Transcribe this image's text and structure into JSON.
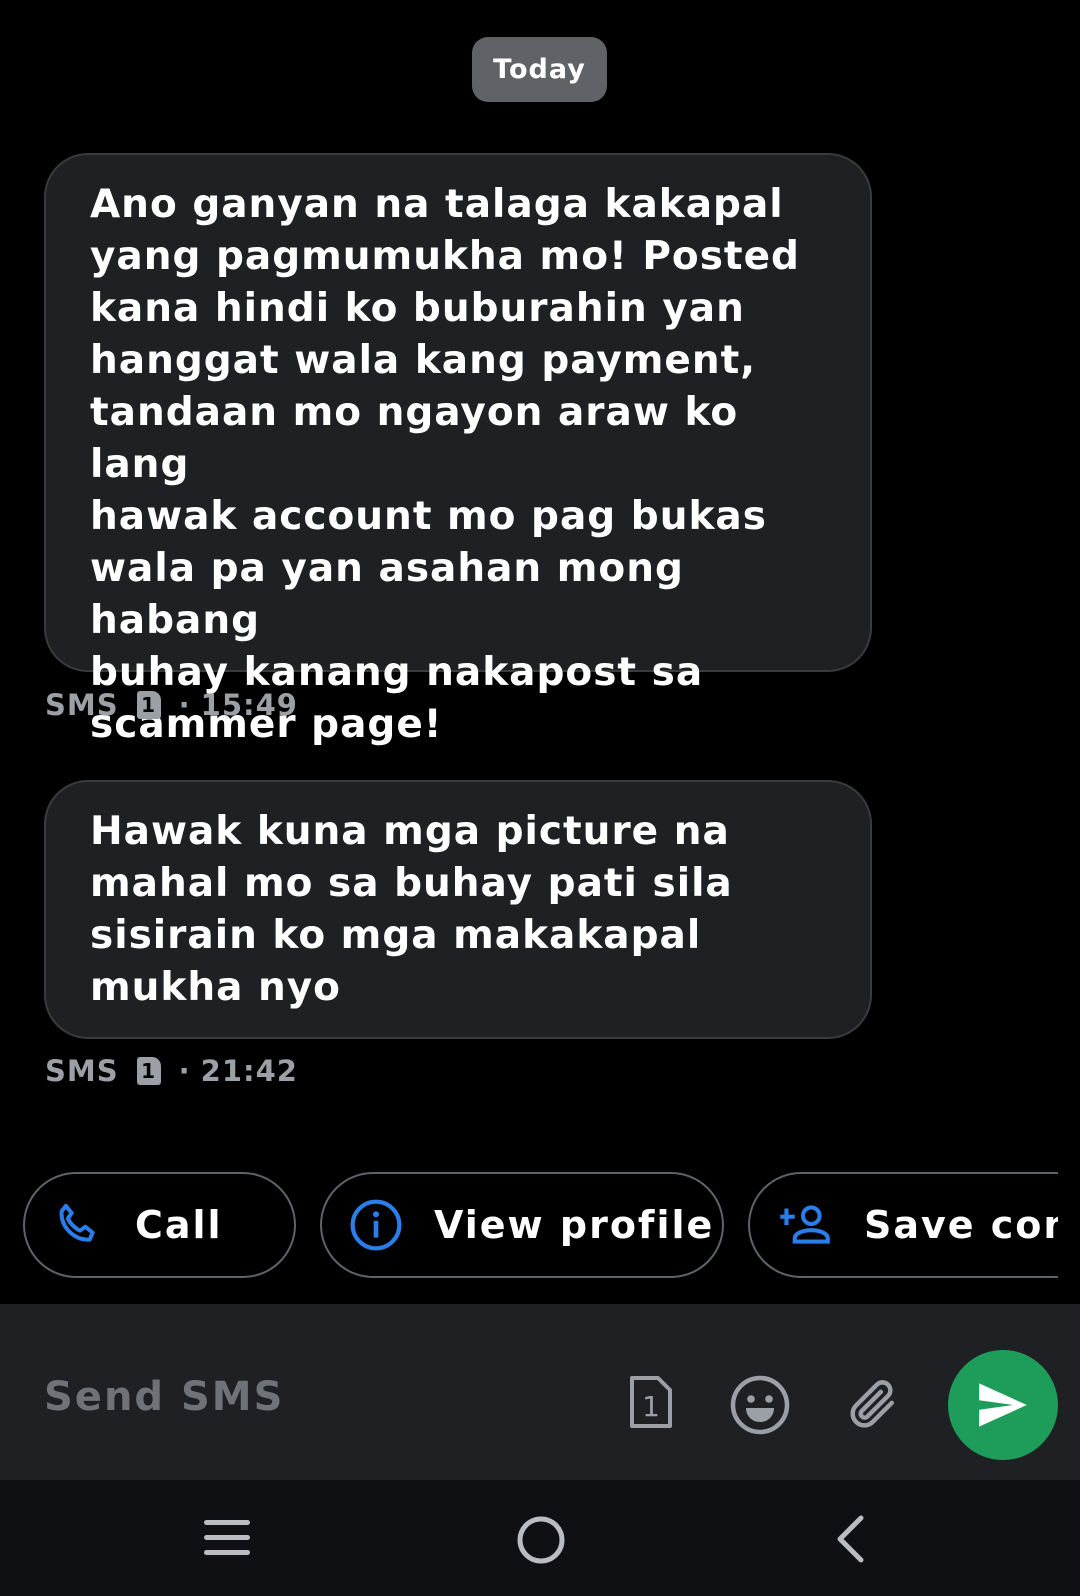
{
  "date_divider": "Today",
  "messages": [
    {
      "text": "Ano ganyan na talaga kakapal\nyang pagmumukha mo! Posted\nkana hindi ko buburahin yan\nhanggat wala kang payment,\ntandaan mo ngayon araw ko lang\nhawak account mo pag bukas\nwala pa yan asahan mong habang\nbuhay kanang nakapost sa\nscammer page!",
      "type": "SMS",
      "sim": "1",
      "time": "15:49"
    },
    {
      "text": "Hawak kuna mga picture na\nmahal mo sa buhay pati sila\nsisirain ko mga makakapal\nmukha nyo",
      "type": "SMS",
      "sim": "1",
      "time": "21:42"
    }
  ],
  "suggestions": {
    "call": "Call",
    "view_profile": "View profile",
    "save_contact": "Save contact"
  },
  "composer": {
    "placeholder": "Send SMS",
    "sim_label": "1"
  },
  "icons": {
    "call": "phone-icon",
    "view_profile": "info-icon",
    "save_contact": "add-person-icon",
    "sim": "sim-card-icon",
    "emoji": "emoji-icon",
    "attach": "paperclip-icon",
    "send": "send-icon",
    "nav_recents": "recents-icon",
    "nav_home": "home-icon",
    "nav_back": "back-icon"
  },
  "colors": {
    "background": "#000000",
    "bubble": "#1f2024",
    "accent_blue": "#2b7de9",
    "send_green": "#1e9c5a",
    "meta_text": "#9aa0a6"
  }
}
